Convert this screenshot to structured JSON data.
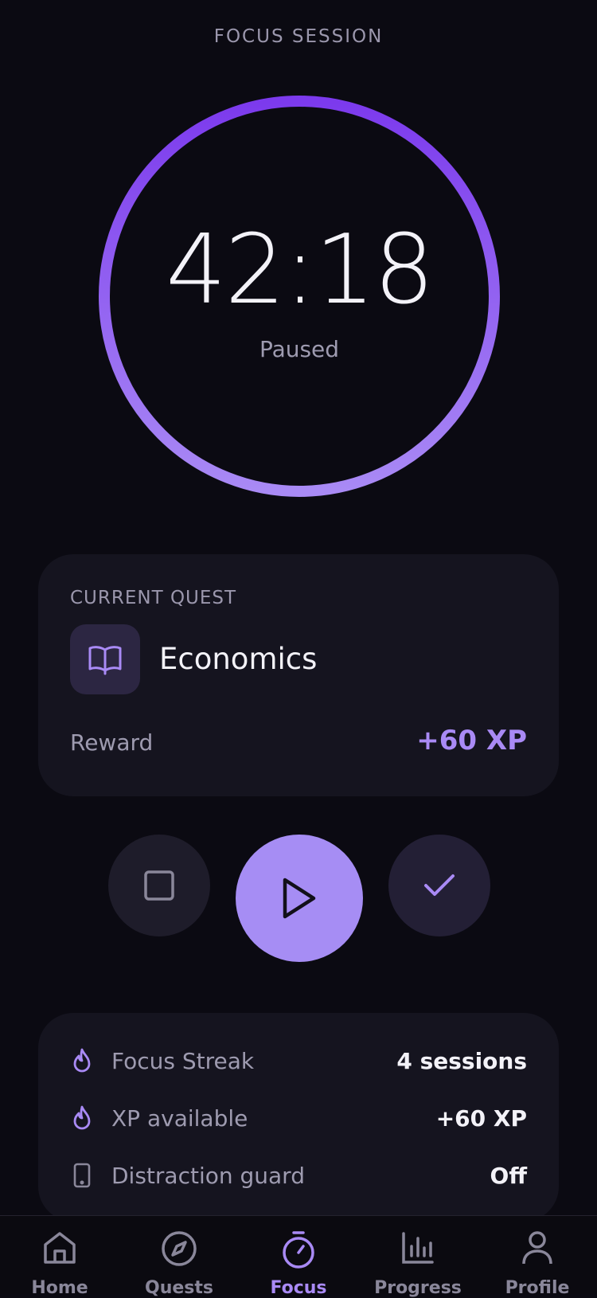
{
  "header": {
    "title": "FOCUS SESSION"
  },
  "timer": {
    "time": "42:18",
    "status": "Paused",
    "progress": 1.0,
    "ring_color_start": "#7c3aed",
    "ring_color_end": "#a98af5"
  },
  "quest": {
    "label": "CURRENT QUEST",
    "icon": "book-icon",
    "name": "Economics",
    "reward_label": "Reward",
    "reward_value": "+60 XP"
  },
  "controls": {
    "stop_icon": "stop-icon",
    "play_icon": "play-icon",
    "complete_icon": "check-icon"
  },
  "stats": [
    {
      "icon": "flame-icon",
      "label": "Focus Streak",
      "value": "4 sessions"
    },
    {
      "icon": "flame-icon",
      "label": "XP available",
      "value": "+60 XP"
    },
    {
      "icon": "phone-icon",
      "label": "Distraction guard",
      "value": "Off"
    }
  ],
  "tabs": [
    {
      "label": "Home",
      "icon": "home-icon",
      "active": false
    },
    {
      "label": "Quests",
      "icon": "compass-icon",
      "active": false
    },
    {
      "label": "Focus",
      "icon": "stopwatch-icon",
      "active": true
    },
    {
      "label": "Progress",
      "icon": "bar-chart-icon",
      "active": false
    },
    {
      "label": "Profile",
      "icon": "user-icon",
      "active": false
    }
  ],
  "colors": {
    "accent": "#a98af5",
    "background": "#0b0a12",
    "card": "#15141f"
  }
}
